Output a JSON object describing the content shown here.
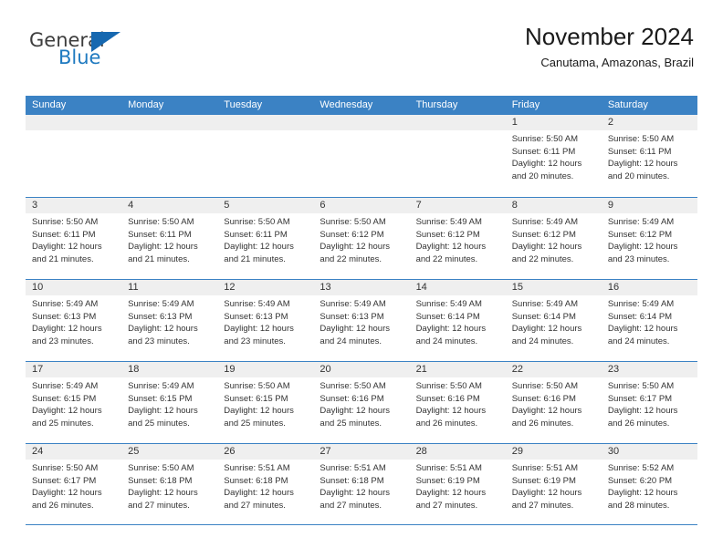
{
  "brand": {
    "name_part1": "General",
    "name_part2": "Blue",
    "logo_icon": "triangle-logo-icon",
    "accent_color": "#1668b0"
  },
  "header": {
    "title": "November 2024",
    "subtitle": "Canutama, Amazonas, Brazil"
  },
  "theme": {
    "header_blue": "#3b82c4",
    "day_band_gray": "#efefef",
    "text_color": "#333333"
  },
  "calendar": {
    "weekdays": [
      "Sunday",
      "Monday",
      "Tuesday",
      "Wednesday",
      "Thursday",
      "Friday",
      "Saturday"
    ],
    "weeks": [
      [
        {
          "day": "",
          "empty": true,
          "lines": []
        },
        {
          "day": "",
          "empty": true,
          "lines": []
        },
        {
          "day": "",
          "empty": true,
          "lines": []
        },
        {
          "day": "",
          "empty": true,
          "lines": []
        },
        {
          "day": "",
          "empty": true,
          "lines": []
        },
        {
          "day": "1",
          "empty": false,
          "lines": [
            "Sunrise: 5:50 AM",
            "Sunset: 6:11 PM",
            "Daylight: 12 hours",
            "and 20 minutes."
          ]
        },
        {
          "day": "2",
          "empty": false,
          "lines": [
            "Sunrise: 5:50 AM",
            "Sunset: 6:11 PM",
            "Daylight: 12 hours",
            "and 20 minutes."
          ]
        }
      ],
      [
        {
          "day": "3",
          "empty": false,
          "lines": [
            "Sunrise: 5:50 AM",
            "Sunset: 6:11 PM",
            "Daylight: 12 hours",
            "and 21 minutes."
          ]
        },
        {
          "day": "4",
          "empty": false,
          "lines": [
            "Sunrise: 5:50 AM",
            "Sunset: 6:11 PM",
            "Daylight: 12 hours",
            "and 21 minutes."
          ]
        },
        {
          "day": "5",
          "empty": false,
          "lines": [
            "Sunrise: 5:50 AM",
            "Sunset: 6:11 PM",
            "Daylight: 12 hours",
            "and 21 minutes."
          ]
        },
        {
          "day": "6",
          "empty": false,
          "lines": [
            "Sunrise: 5:50 AM",
            "Sunset: 6:12 PM",
            "Daylight: 12 hours",
            "and 22 minutes."
          ]
        },
        {
          "day": "7",
          "empty": false,
          "lines": [
            "Sunrise: 5:49 AM",
            "Sunset: 6:12 PM",
            "Daylight: 12 hours",
            "and 22 minutes."
          ]
        },
        {
          "day": "8",
          "empty": false,
          "lines": [
            "Sunrise: 5:49 AM",
            "Sunset: 6:12 PM",
            "Daylight: 12 hours",
            "and 22 minutes."
          ]
        },
        {
          "day": "9",
          "empty": false,
          "lines": [
            "Sunrise: 5:49 AM",
            "Sunset: 6:12 PM",
            "Daylight: 12 hours",
            "and 23 minutes."
          ]
        }
      ],
      [
        {
          "day": "10",
          "empty": false,
          "lines": [
            "Sunrise: 5:49 AM",
            "Sunset: 6:13 PM",
            "Daylight: 12 hours",
            "and 23 minutes."
          ]
        },
        {
          "day": "11",
          "empty": false,
          "lines": [
            "Sunrise: 5:49 AM",
            "Sunset: 6:13 PM",
            "Daylight: 12 hours",
            "and 23 minutes."
          ]
        },
        {
          "day": "12",
          "empty": false,
          "lines": [
            "Sunrise: 5:49 AM",
            "Sunset: 6:13 PM",
            "Daylight: 12 hours",
            "and 23 minutes."
          ]
        },
        {
          "day": "13",
          "empty": false,
          "lines": [
            "Sunrise: 5:49 AM",
            "Sunset: 6:13 PM",
            "Daylight: 12 hours",
            "and 24 minutes."
          ]
        },
        {
          "day": "14",
          "empty": false,
          "lines": [
            "Sunrise: 5:49 AM",
            "Sunset: 6:14 PM",
            "Daylight: 12 hours",
            "and 24 minutes."
          ]
        },
        {
          "day": "15",
          "empty": false,
          "lines": [
            "Sunrise: 5:49 AM",
            "Sunset: 6:14 PM",
            "Daylight: 12 hours",
            "and 24 minutes."
          ]
        },
        {
          "day": "16",
          "empty": false,
          "lines": [
            "Sunrise: 5:49 AM",
            "Sunset: 6:14 PM",
            "Daylight: 12 hours",
            "and 24 minutes."
          ]
        }
      ],
      [
        {
          "day": "17",
          "empty": false,
          "lines": [
            "Sunrise: 5:49 AM",
            "Sunset: 6:15 PM",
            "Daylight: 12 hours",
            "and 25 minutes."
          ]
        },
        {
          "day": "18",
          "empty": false,
          "lines": [
            "Sunrise: 5:49 AM",
            "Sunset: 6:15 PM",
            "Daylight: 12 hours",
            "and 25 minutes."
          ]
        },
        {
          "day": "19",
          "empty": false,
          "lines": [
            "Sunrise: 5:50 AM",
            "Sunset: 6:15 PM",
            "Daylight: 12 hours",
            "and 25 minutes."
          ]
        },
        {
          "day": "20",
          "empty": false,
          "lines": [
            "Sunrise: 5:50 AM",
            "Sunset: 6:16 PM",
            "Daylight: 12 hours",
            "and 25 minutes."
          ]
        },
        {
          "day": "21",
          "empty": false,
          "lines": [
            "Sunrise: 5:50 AM",
            "Sunset: 6:16 PM",
            "Daylight: 12 hours",
            "and 26 minutes."
          ]
        },
        {
          "day": "22",
          "empty": false,
          "lines": [
            "Sunrise: 5:50 AM",
            "Sunset: 6:16 PM",
            "Daylight: 12 hours",
            "and 26 minutes."
          ]
        },
        {
          "day": "23",
          "empty": false,
          "lines": [
            "Sunrise: 5:50 AM",
            "Sunset: 6:17 PM",
            "Daylight: 12 hours",
            "and 26 minutes."
          ]
        }
      ],
      [
        {
          "day": "24",
          "empty": false,
          "lines": [
            "Sunrise: 5:50 AM",
            "Sunset: 6:17 PM",
            "Daylight: 12 hours",
            "and 26 minutes."
          ]
        },
        {
          "day": "25",
          "empty": false,
          "lines": [
            "Sunrise: 5:50 AM",
            "Sunset: 6:18 PM",
            "Daylight: 12 hours",
            "and 27 minutes."
          ]
        },
        {
          "day": "26",
          "empty": false,
          "lines": [
            "Sunrise: 5:51 AM",
            "Sunset: 6:18 PM",
            "Daylight: 12 hours",
            "and 27 minutes."
          ]
        },
        {
          "day": "27",
          "empty": false,
          "lines": [
            "Sunrise: 5:51 AM",
            "Sunset: 6:18 PM",
            "Daylight: 12 hours",
            "and 27 minutes."
          ]
        },
        {
          "day": "28",
          "empty": false,
          "lines": [
            "Sunrise: 5:51 AM",
            "Sunset: 6:19 PM",
            "Daylight: 12 hours",
            "and 27 minutes."
          ]
        },
        {
          "day": "29",
          "empty": false,
          "lines": [
            "Sunrise: 5:51 AM",
            "Sunset: 6:19 PM",
            "Daylight: 12 hours",
            "and 27 minutes."
          ]
        },
        {
          "day": "30",
          "empty": false,
          "lines": [
            "Sunrise: 5:52 AM",
            "Sunset: 6:20 PM",
            "Daylight: 12 hours",
            "and 28 minutes."
          ]
        }
      ]
    ]
  }
}
